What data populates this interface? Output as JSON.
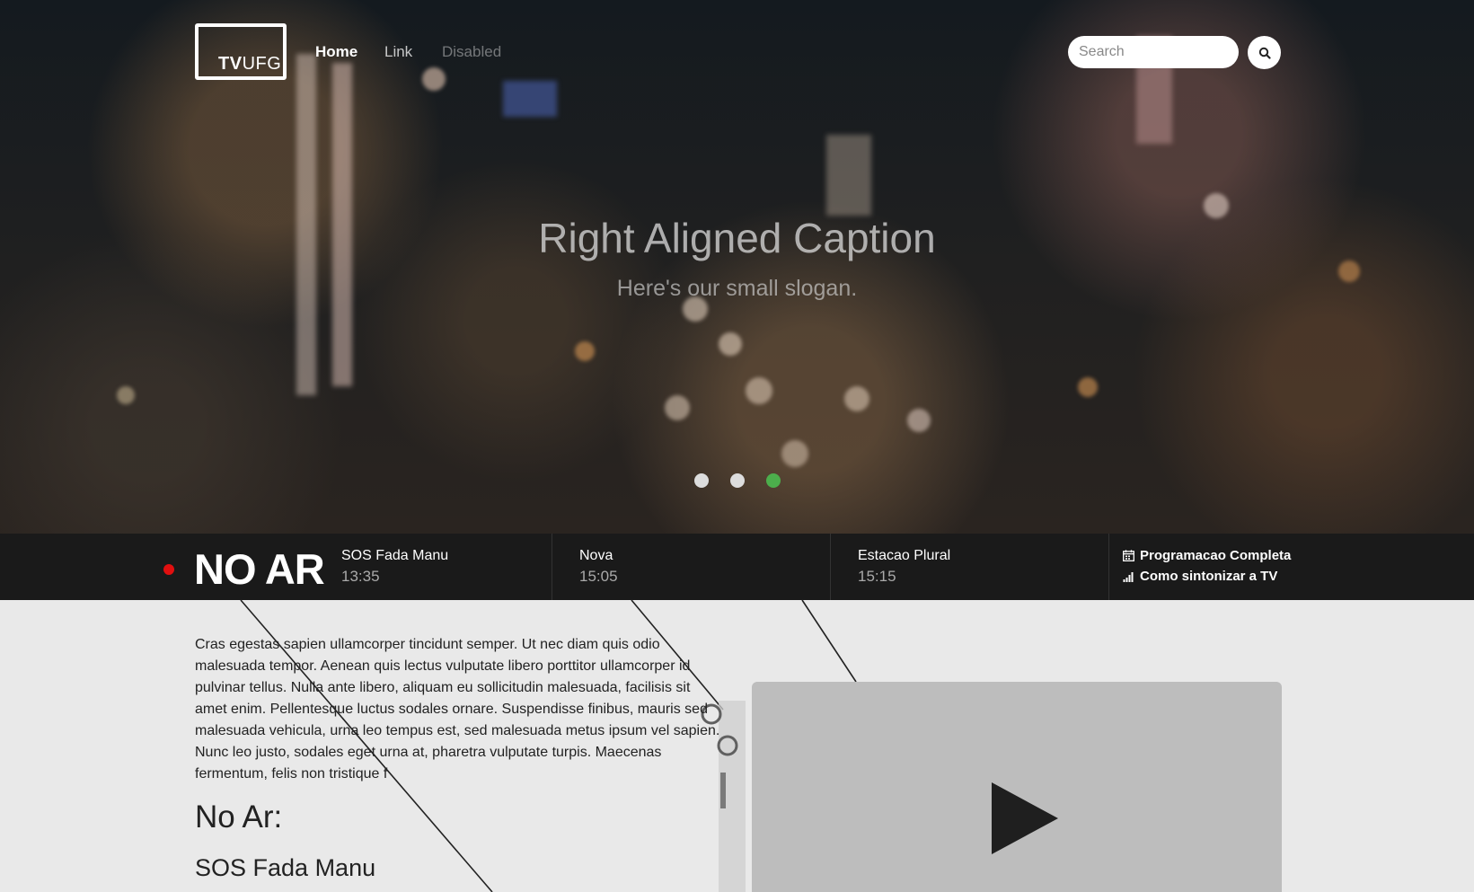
{
  "brand": {
    "logo_bold": "TV",
    "logo_rest": "UFG"
  },
  "nav": {
    "items": [
      {
        "label": "Home",
        "state": "active"
      },
      {
        "label": "Link",
        "state": "normal"
      },
      {
        "label": "Disabled",
        "state": "disabled"
      }
    ]
  },
  "search": {
    "placeholder": "Search",
    "button_icon": "search-icon"
  },
  "hero": {
    "title": "Right Aligned Caption",
    "slogan": "Here's our small slogan.",
    "carousel": {
      "count": 3,
      "active_index": 2
    }
  },
  "ticker": {
    "live_label": "NO AR",
    "programs": [
      {
        "name": "SOS Fada Manu",
        "time": "13:35"
      },
      {
        "name": "Nova",
        "time": "15:05"
      },
      {
        "name": "Estacao Plural",
        "time": "15:15"
      }
    ],
    "links": [
      {
        "icon": "calendar-icon",
        "label": "Programacao Completa"
      },
      {
        "icon": "signal-icon",
        "label": "Como sintonizar a TV"
      }
    ]
  },
  "content": {
    "paragraph": "Cras egestas sapien ullamcorper tincidunt semper. Ut nec diam quis odio malesuada tempor. Aenean quis lectus vulputate libero porttitor ullamcorper id pulvinar tellus. Nulla ante libero, aliquam eu sollicitudin malesuada, facilisis sit amet enim. Pellentesque luctus sodales ornare. Suspendisse finibus, mauris sed malesuada vehicula, urna leo tempus est, sed malesuada metus ipsum vel sapien. Nunc leo justo, sodales eget urna at, pharetra vulputate turpis. Maecenas fermentum, felis non tristique f",
    "heading": "No Ar:",
    "subheading": "SOS Fada Manu",
    "video_icon": "play-icon"
  },
  "colors": {
    "live_red": "#e10f0f",
    "active_dot": "#4cae4c",
    "ticker_bg": "#080808",
    "content_bg": "#e9e9e9"
  }
}
